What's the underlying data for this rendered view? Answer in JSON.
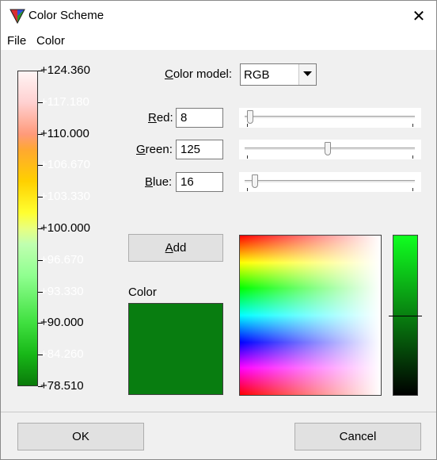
{
  "window": {
    "title": "Color Scheme",
    "close_glyph": "✕"
  },
  "menu": {
    "file": "File",
    "color": "Color"
  },
  "scale": {
    "labels": [
      "+124.360",
      "+117.180",
      "+110.000",
      "+106.670",
      "+103.330",
      "+100.000",
      "+96.670",
      "+93.330",
      "+90.000",
      "+84.260",
      "+78.510"
    ]
  },
  "form": {
    "color_model_label_u": "C",
    "color_model_label_rest": "olor model:",
    "color_model_value": "RGB",
    "red_label_u": "R",
    "red_label_rest": "ed:",
    "red_value": "8",
    "green_label_u": "G",
    "green_label_rest": "reen:",
    "green_value": "125",
    "blue_label_u": "B",
    "blue_label_rest": "lue:",
    "blue_value": "16"
  },
  "sliders": {
    "red": 8,
    "green": 125,
    "blue": 16,
    "max": 255
  },
  "add_button": {
    "u": "A",
    "rest": "dd"
  },
  "color_label": "Color",
  "current_color": "#087d10",
  "footer": {
    "ok": "OK",
    "cancel": "Cancel"
  },
  "icons": {
    "app": "color-scheme-app-icon",
    "close": "close-icon",
    "dropdown": "chevron-down-icon"
  }
}
